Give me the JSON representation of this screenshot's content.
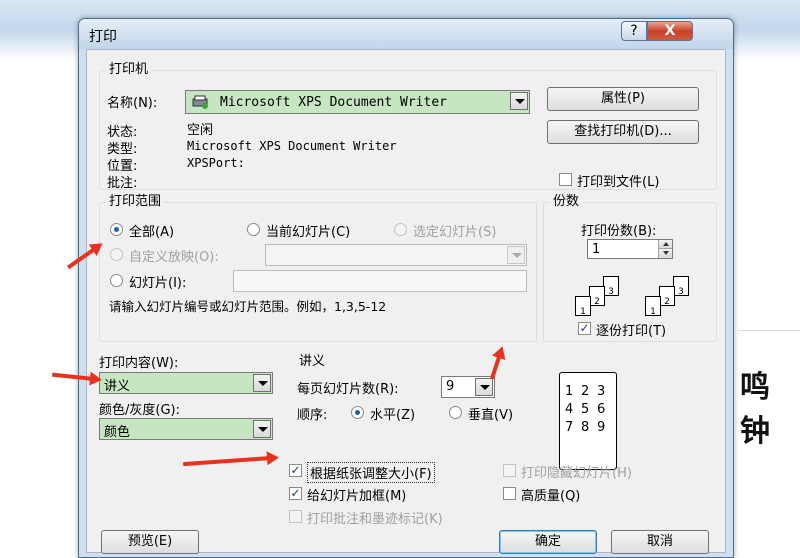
{
  "dialog": {
    "title": "打印",
    "help_label": "?",
    "close_label": "X"
  },
  "printer": {
    "group_title": "打印机",
    "name_label": "名称(N):",
    "name_value": "Microsoft XPS Document Writer",
    "properties_button": "属性(P)",
    "find_printer_button": "查找打印机(D)...",
    "status_label": "状态:",
    "status_value": "空闲",
    "type_label": "类型:",
    "type_value": "Microsoft XPS Document Writer",
    "location_label": "位置:",
    "location_value": "XPSPort:",
    "comment_label": "批注:",
    "print_to_file_label": "打印到文件(L)",
    "print_to_file_checked": false
  },
  "range": {
    "group_title": "打印范围",
    "all_label": "全部(A)",
    "current_slide_label": "当前幻灯片(C)",
    "selection_label": "选定幻灯片(S)",
    "custom_show_label": "自定义放映(O):",
    "slides_label": "幻灯片(I):",
    "hint": "请输入幻灯片编号或幻灯片范围。例如，1,3,5-12",
    "selected": "all"
  },
  "copies": {
    "group_title": "份数",
    "count_label": "打印份数(B):",
    "count_value": "1",
    "collate_label": "逐份打印(T)",
    "collate_checked": true,
    "page_numbers": [
      "1",
      "2",
      "3"
    ]
  },
  "print_what": {
    "label": "打印内容(W):",
    "value": "讲义"
  },
  "color": {
    "label": "颜色/灰度(G):",
    "value": "颜色"
  },
  "handouts": {
    "group_title": "讲义",
    "per_page_label": "每页幻灯片数(R):",
    "per_page_value": "9",
    "order_label": "顺序:",
    "horizontal_label": "水平(Z)",
    "vertical_label": "垂直(V)",
    "order_selected": "horizontal",
    "preview_numbers": [
      "1",
      "2",
      "3",
      "4",
      "5",
      "6",
      "7",
      "8",
      "9"
    ]
  },
  "options": {
    "scale_to_fit_label": "根据纸张调整大小(F)",
    "scale_to_fit_checked": true,
    "frame_slides_label": "给幻灯片加框(M)",
    "frame_slides_checked": true,
    "print_comments_label": "打印批注和墨迹标记(K)",
    "print_hidden_label": "打印隐藏幻灯片(H)",
    "high_quality_label": "高质量(Q)",
    "high_quality_checked": false
  },
  "footer": {
    "preview_button": "预览(E)",
    "ok_button": "确定",
    "cancel_button": "取消"
  },
  "background": {
    "text_fragment": "鸣钟"
  },
  "colors": {
    "annotation_arrow": "#e8321e",
    "selected_field": "#c6e6c1",
    "dialog_frame": "#cfdff0"
  }
}
